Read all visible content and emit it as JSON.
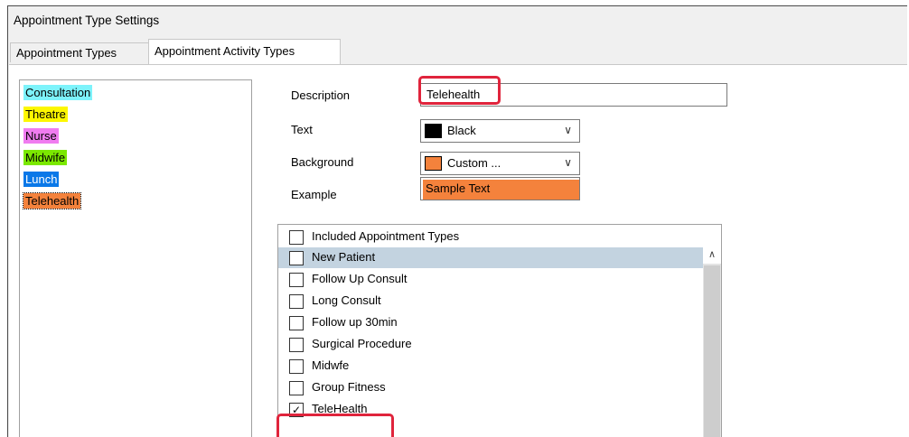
{
  "window": {
    "title": "Appointment Type Settings"
  },
  "tabs": [
    {
      "label": "Appointment Types",
      "active": false
    },
    {
      "label": "Appointment Activity Types",
      "active": true
    }
  ],
  "activity_types": [
    {
      "label": "Consultation",
      "bg": "#7df3fb",
      "fg": "#000000",
      "selected": false
    },
    {
      "label": "Theatre",
      "bg": "#fdf700",
      "fg": "#000000",
      "selected": false
    },
    {
      "label": "Nurse",
      "bg": "#f07cf0",
      "fg": "#000000",
      "selected": false
    },
    {
      "label": "Midwife",
      "bg": "#7be800",
      "fg": "#000000",
      "selected": false
    },
    {
      "label": "Lunch",
      "bg": "#0a78e8",
      "fg": "#ffffff",
      "selected": false
    },
    {
      "label": "Telehealth",
      "bg": "#f4823c",
      "fg": "#000000",
      "selected": true
    }
  ],
  "form": {
    "description_label": "Description",
    "description_value": "Telehealth",
    "text_label": "Text",
    "text_color_name": "Black",
    "text_color": "#000000",
    "background_label": "Background",
    "background_color_name": "Custom ...",
    "background_color": "#f4823c",
    "example_label": "Example",
    "example_text": "Sample Text"
  },
  "included": {
    "header_label": "Included Appointment Types",
    "header_checked": false,
    "items": [
      {
        "label": "New Patient",
        "checked": false,
        "selected": true
      },
      {
        "label": "Follow Up Consult",
        "checked": false,
        "selected": false
      },
      {
        "label": "Long Consult",
        "checked": false,
        "selected": false
      },
      {
        "label": "Follow up 30min",
        "checked": false,
        "selected": false
      },
      {
        "label": "Surgical Procedure",
        "checked": false,
        "selected": false
      },
      {
        "label": "Midwfe",
        "checked": false,
        "selected": false
      },
      {
        "label": "Group Fitness",
        "checked": false,
        "selected": false
      },
      {
        "label": "TeleHealth",
        "checked": true,
        "selected": false
      }
    ]
  },
  "icons": {
    "dropdown": "chevron-down-icon",
    "scroll_up": "chevron-up-icon",
    "check": "checkmark-icon"
  },
  "colors": {
    "highlight": "#e0243c",
    "selection": "#c3d3e0"
  }
}
